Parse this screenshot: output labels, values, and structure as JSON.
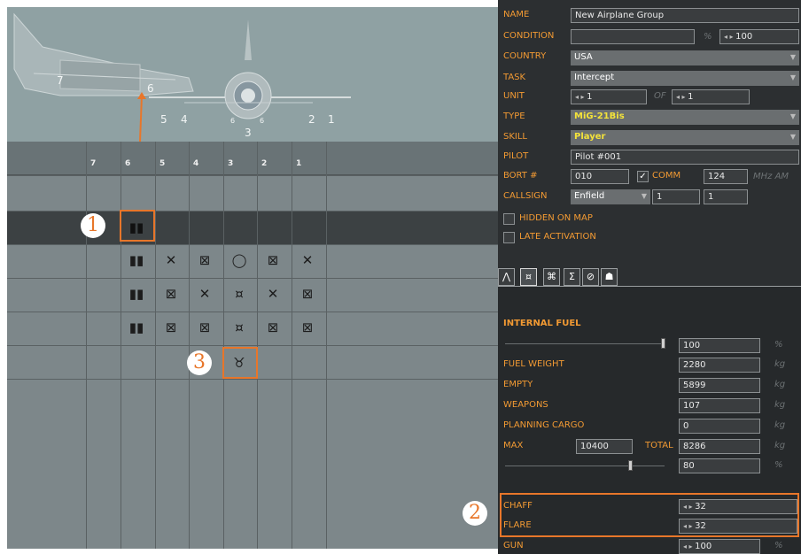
{
  "preview": {
    "side_labels": [
      "7",
      "6"
    ],
    "front_labels": [
      "5",
      "4",
      "6",
      "6",
      "3",
      "2",
      "1"
    ]
  },
  "grid": {
    "columns": [
      "7",
      "6",
      "5",
      "4",
      "3",
      "2",
      "1"
    ]
  },
  "callouts": [
    "1",
    "2",
    "3"
  ],
  "icons": {
    "pylon6": "missile-pair-icon",
    "rack": "rack-icon"
  },
  "form": {
    "name_label": "NAME",
    "name_value": "New Airplane Group",
    "condition_label": "CONDITION",
    "condition_pct": "%",
    "condition_value": "100",
    "country_label": "COUNTRY",
    "country_value": "USA",
    "task_label": "TASK",
    "task_value": "Intercept",
    "unit_label": "UNIT",
    "unit_value": "1",
    "unit_of": "OF",
    "unit_of_value": "1",
    "type_label": "TYPE",
    "type_value": "MiG-21Bis",
    "skill_label": "SKILL",
    "skill_value": "Player",
    "pilot_label": "PILOT",
    "pilot_value": "Pilot #001",
    "bort_label": "BORT #",
    "bort_value": "010",
    "comm_label": "COMM",
    "comm_value": "124",
    "comm_unit": "MHz AM",
    "callsign_label": "CALLSIGN",
    "callsign_value": "Enfield",
    "callsign_n1": "1",
    "callsign_n2": "1",
    "hidden_label": "HIDDEN ON MAP",
    "late_label": "LATE ACTIVATION"
  },
  "tabs": [
    "⋀",
    "¤",
    "⌘",
    "Σ",
    "⊘",
    "☗"
  ],
  "fuel": {
    "title": "INTERNAL FUEL",
    "internal_value": "100",
    "internal_unit": "%",
    "weight_label": "FUEL WEIGHT",
    "weight_value": "2280",
    "weight_unit": "kg",
    "empty_label": "EMPTY",
    "empty_value": "5899",
    "empty_unit": "kg",
    "weapons_label": "WEAPONS",
    "weapons_value": "107",
    "weapons_unit": "kg",
    "cargo_label": "PLANNING CARGO",
    "cargo_value": "0",
    "cargo_unit": "kg",
    "max_label": "MAX",
    "max_value": "10400",
    "total_label": "TOTAL",
    "total_value": "8286",
    "total_unit": "kg",
    "pct_value": "80",
    "pct_unit": "%",
    "chaff_label": "CHAFF",
    "chaff_value": "32",
    "flare_label": "FLARE",
    "flare_value": "32",
    "gun_label": "GUN",
    "gun_value": "100",
    "gun_unit": "%"
  },
  "colors": {
    "accent": "#e8762a",
    "label": "#f29a33",
    "highlight_text": "#f4e33a"
  }
}
